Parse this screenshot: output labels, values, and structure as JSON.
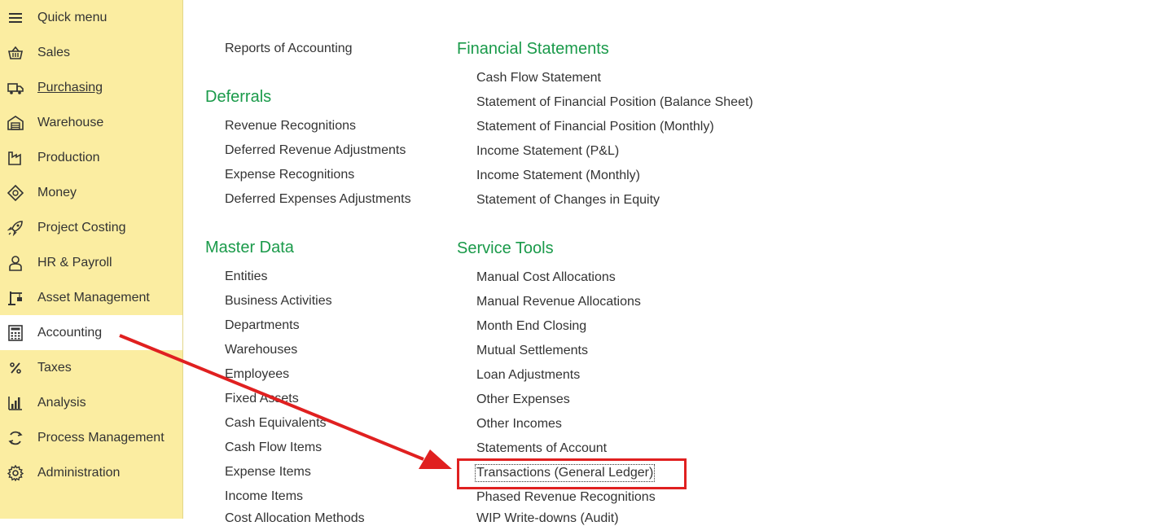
{
  "sidebar": {
    "items": [
      {
        "label": "Quick menu",
        "icon": "hamburger-menu-icon"
      },
      {
        "label": "Sales",
        "icon": "basket-icon"
      },
      {
        "label": "Purchasing",
        "icon": "truck-icon"
      },
      {
        "label": "Warehouse",
        "icon": "warehouse-icon"
      },
      {
        "label": "Production",
        "icon": "factory-icon"
      },
      {
        "label": "Money",
        "icon": "money-icon"
      },
      {
        "label": "Project Costing",
        "icon": "rocket-icon"
      },
      {
        "label": "HR & Payroll",
        "icon": "person-icon"
      },
      {
        "label": "Asset Management",
        "icon": "crane-icon"
      },
      {
        "label": "Accounting",
        "icon": "calculator-icon"
      },
      {
        "label": "Taxes",
        "icon": "percent-icon"
      },
      {
        "label": "Analysis",
        "icon": "bar-chart-icon"
      },
      {
        "label": "Process Management",
        "icon": "cycle-icon"
      },
      {
        "label": "Administration",
        "icon": "gear-icon"
      }
    ],
    "active_item": "Accounting"
  },
  "main": {
    "left_column": {
      "top_link": "Reports of Accounting",
      "deferrals": {
        "title": "Deferrals",
        "links": [
          "Revenue Recognitions",
          "Deferred Revenue Adjustments",
          "Expense Recognitions",
          "Deferred Expenses Adjustments"
        ]
      },
      "master_data": {
        "title": "Master Data",
        "links": [
          "Entities",
          "Business Activities",
          "Departments",
          "Warehouses",
          "Employees",
          "Fixed Assets",
          "Cash Equivalents",
          "Cash Flow Items",
          "Expense Items",
          "Income Items",
          "Cost Allocation Methods"
        ]
      }
    },
    "right_column": {
      "financial_statements": {
        "title": "Financial Statements",
        "links": [
          "Cash Flow Statement",
          "Statement of Financial Position (Balance Sheet)",
          "Statement of Financial Position (Monthly)",
          "Income Statement (P&L)",
          "Income Statement (Monthly)",
          "Statement of Changes in Equity"
        ]
      },
      "service_tools": {
        "title": "Service Tools",
        "links": [
          "Manual Cost Allocations",
          "Manual Revenue Allocations",
          "Month End Closing",
          "Mutual Settlements",
          "Loan Adjustments",
          "Other Expenses",
          "Other Incomes",
          "Statements of Account",
          "Transactions (General Ledger)",
          "Phased Revenue Recognitions",
          "WIP Write-downs (Audit)"
        ]
      }
    }
  },
  "colors": {
    "sidebar_bg": "#fbeda1",
    "section_title": "#1a9a4a",
    "annotation_red": "#e02020"
  }
}
